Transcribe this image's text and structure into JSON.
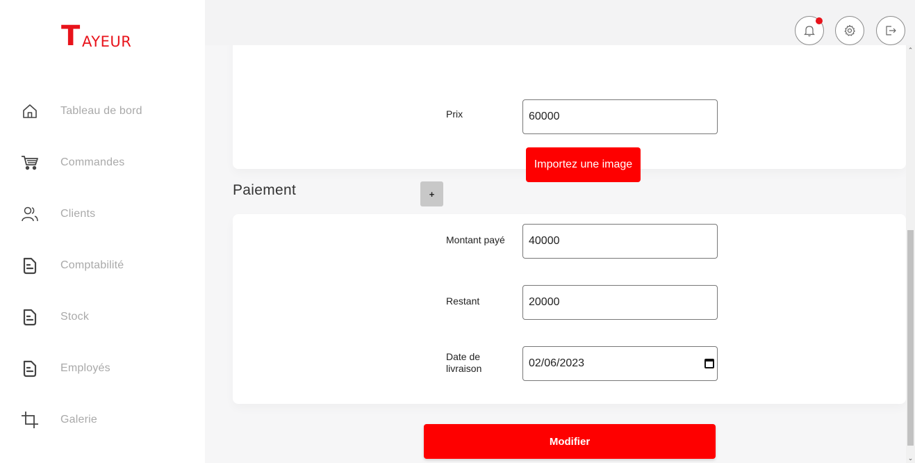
{
  "app": {
    "logo_initial": "T",
    "logo_rest": "AYEUR",
    "brand_color": "#e8131b"
  },
  "sidebar": {
    "items": [
      {
        "label": "Tableau de bord",
        "icon": "home-icon"
      },
      {
        "label": "Commandes",
        "icon": "cart-icon"
      },
      {
        "label": "Clients",
        "icon": "users-icon"
      },
      {
        "label": "Comptabilité",
        "icon": "document-icon"
      },
      {
        "label": "Stock",
        "icon": "document-icon"
      },
      {
        "label": "Employés",
        "icon": "document-icon"
      },
      {
        "label": "Galerie",
        "icon": "crop-icon"
      }
    ]
  },
  "topbar": {
    "icons": [
      "bell-icon",
      "gear-icon",
      "logout-icon"
    ],
    "notification_active": true
  },
  "order_card": {
    "price_label": "Prix",
    "price_value": "60000",
    "import_label": "Importez une image",
    "add_label": "+"
  },
  "payment": {
    "title": "Paiement",
    "paid_label": "Montant payé",
    "paid_value": "40000",
    "remaining_label": "Restant",
    "remaining_value": "20000",
    "delivery_label": "Date de livraison",
    "delivery_value": "02/06/2023"
  },
  "actions": {
    "submit_label": "Modifier"
  },
  "colors": {
    "accent": "#fe0000",
    "sidebar_text": "#a9a9a9"
  }
}
